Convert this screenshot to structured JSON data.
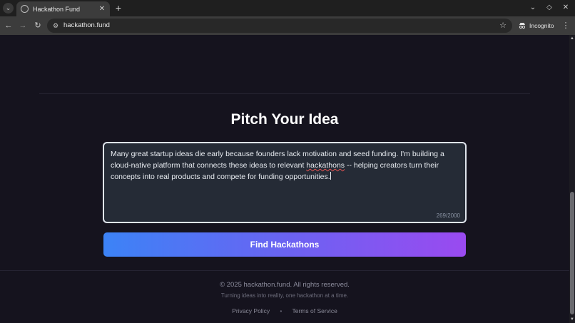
{
  "browser": {
    "tab_title": "Hackathon Fund",
    "tab_close_glyph": "✕",
    "new_tab_glyph": "+",
    "url": "hackathon.fund",
    "incognito_label": "Incognito"
  },
  "page": {
    "heading": "Pitch Your Idea",
    "pitch": {
      "before": "Many great startup ideas die early because founders lack motivation and seed funding. I'm building a cloud-native platform that connects these ideas to relevant ",
      "misspelled": "hackathons",
      "after": " -- helping creators turn their concepts into real products and compete for funding opportunities.",
      "counter": "269/2000"
    },
    "cta_label": "Find Hackathons"
  },
  "footer": {
    "copyright": "© 2025 hackathon.fund. All rights reserved.",
    "tagline": "Turning ideas into reality, one hackathon at a time.",
    "privacy": "Privacy Policy",
    "separator": "•",
    "terms": "Terms of Service"
  },
  "colors": {
    "page_bg": "#15131e",
    "cta_gradient_start": "#3c83f6",
    "cta_gradient_end": "#9a4af0"
  }
}
